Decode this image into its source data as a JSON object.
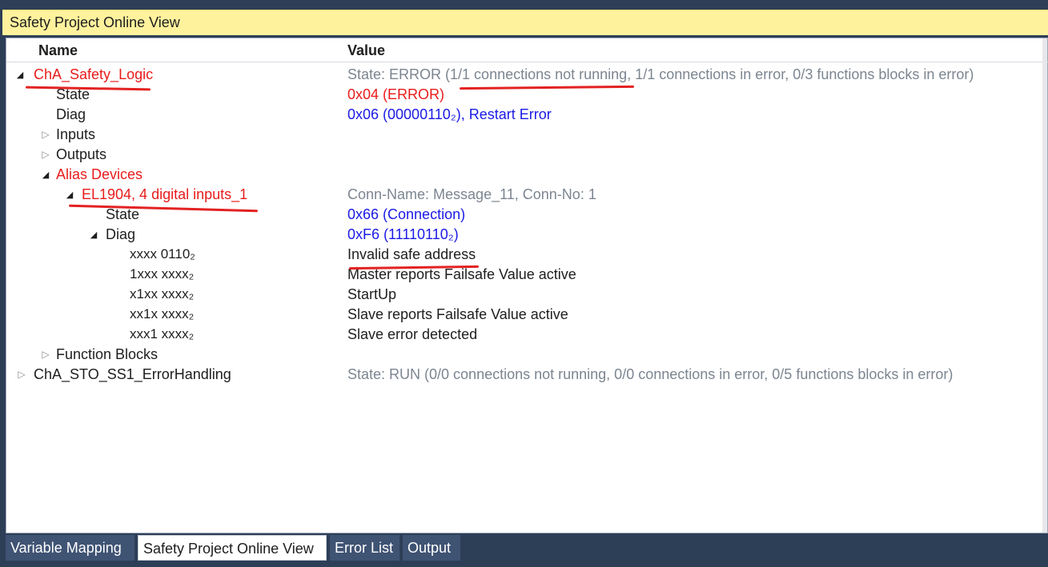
{
  "window": {
    "title": "Safety Project Online View"
  },
  "columns": {
    "name": "Name",
    "value": "Value"
  },
  "rows": [
    {
      "name": "ChA_Safety_Logic",
      "value": "State: ERROR (1/1 connections not running, 1/1 connections in error, 0/3 functions blocks in error)",
      "toggle": "expanded"
    },
    {
      "name": "State",
      "value": "0x04 (ERROR)"
    },
    {
      "name": "Diag",
      "value": "0x06 (00000110₂), Restart Error"
    },
    {
      "name": "Inputs",
      "value": "",
      "toggle": "collapsed"
    },
    {
      "name": "Outputs",
      "value": "",
      "toggle": "collapsed"
    },
    {
      "name": "Alias Devices",
      "value": "",
      "toggle": "expanded"
    },
    {
      "name": "EL1904, 4 digital inputs_1",
      "value": "Conn-Name: Message_11, Conn-No: 1",
      "toggle": "expanded"
    },
    {
      "name": "State",
      "value": "0x66 (Connection)"
    },
    {
      "name": "Diag",
      "value": "0xF6 (11110110₂)",
      "toggle": "expanded"
    },
    {
      "name": "xxxx 0110₂",
      "value": "Invalid safe address"
    },
    {
      "name": "1xxx xxxx₂",
      "value": "Master reports Failsafe Value active"
    },
    {
      "name": "x1xx xxxx₂",
      "value": "StartUp"
    },
    {
      "name": "xx1x xxxx₂",
      "value": "Slave reports Failsafe Value active"
    },
    {
      "name": "xxx1 xxxx₂",
      "value": "Slave error detected"
    },
    {
      "name": "Function Blocks",
      "value": "",
      "toggle": "collapsed"
    },
    {
      "name": "ChA_STO_SS1_ErrorHandling",
      "value": "State: RUN (0/0 connections not running, 0/0 connections in error, 0/5 functions blocks in error)",
      "toggle": "collapsed"
    }
  ],
  "tabs": [
    {
      "label": "Variable Mapping",
      "active": false
    },
    {
      "label": "Safety Project Online View",
      "active": true
    },
    {
      "label": "Error List",
      "active": false
    },
    {
      "label": "Output",
      "active": false
    }
  ],
  "icons": {
    "expanded": "expand-triangle-icon",
    "collapsed": "collapse-triangle-icon"
  },
  "colors": {
    "error": "#e81c1c",
    "info": "#1a1ae6",
    "muted": "#7c8590",
    "annotation": "#e32222"
  }
}
